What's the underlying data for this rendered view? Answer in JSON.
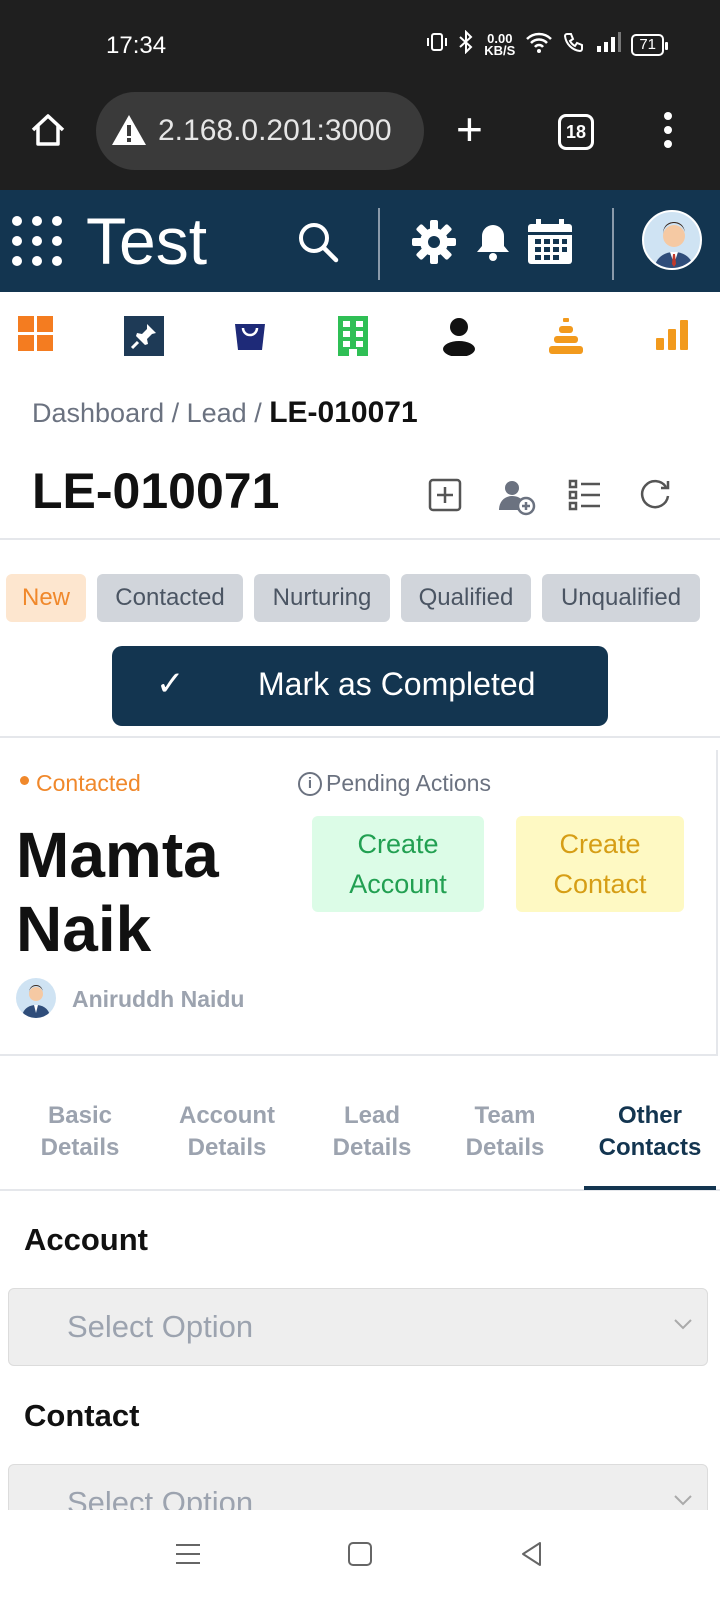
{
  "status_bar": {
    "time": "17:34",
    "net_speed": "0.00",
    "net_unit": "KB/S",
    "battery": "71"
  },
  "browser": {
    "url": "2.168.0.201:3000",
    "tab_count": "18"
  },
  "app": {
    "brand": "Test"
  },
  "breadcrumb": {
    "dashboard": "Dashboard",
    "sep1": " / ",
    "lead": "Lead",
    "sep2": " / ",
    "current": "LE-010071"
  },
  "page_title": "LE-010071",
  "stages": [
    "New",
    "Contacted",
    "Nurturing",
    "Qualified",
    "Unqualified"
  ],
  "active_stage": "New",
  "complete_button": "Mark as Completed",
  "lead": {
    "status": "Contacted",
    "pending_label": "Pending Actions",
    "name": "Mamta Naik",
    "owner": "Aniruddh Naidu",
    "create_account": "Create Account",
    "create_contact": "Create Contact"
  },
  "tabs": [
    {
      "line1": "Basic",
      "line2": "Details"
    },
    {
      "line1": "Account",
      "line2": "Details"
    },
    {
      "line1": "Lead",
      "line2": "Details"
    },
    {
      "line1": "Team",
      "line2": "Details"
    },
    {
      "line1": "Other",
      "line2": "Contacts"
    }
  ],
  "active_tab": "Other Contacts",
  "form": {
    "account_label": "Account",
    "account_placeholder": "Select Option",
    "contact_label": "Contact",
    "contact_placeholder": "Select Option"
  },
  "colors": {
    "primary": "#133550",
    "accent_orange": "#f0882b",
    "green": "#22a052",
    "yellow": "#d69e16"
  }
}
